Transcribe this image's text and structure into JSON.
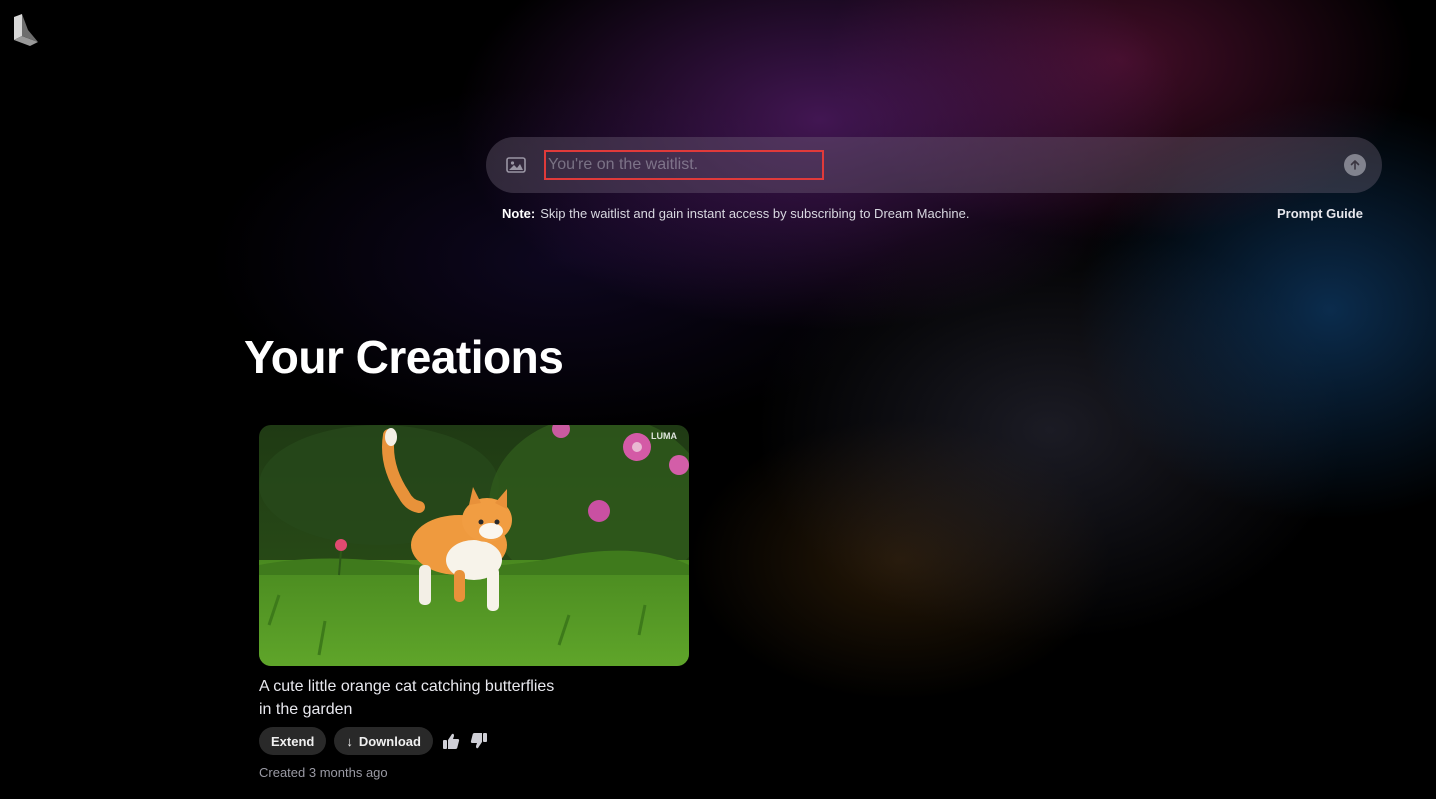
{
  "prompt": {
    "placeholder": "You're on the waitlist.",
    "icon_left": "image-icon",
    "icon_right": "send-arrow-icon",
    "note_label": "Note:",
    "note_text": "Skip the waitlist and gain instant access by subscribing to Dream Machine.",
    "guide_link": "Prompt Guide"
  },
  "section_title": "Your Creations",
  "creations": [
    {
      "watermark": "LUMA",
      "caption": "A cute little orange cat catching butterflies in the garden",
      "extend_label": "Extend",
      "download_label": "Download",
      "created": "Created 3 months ago"
    }
  ]
}
